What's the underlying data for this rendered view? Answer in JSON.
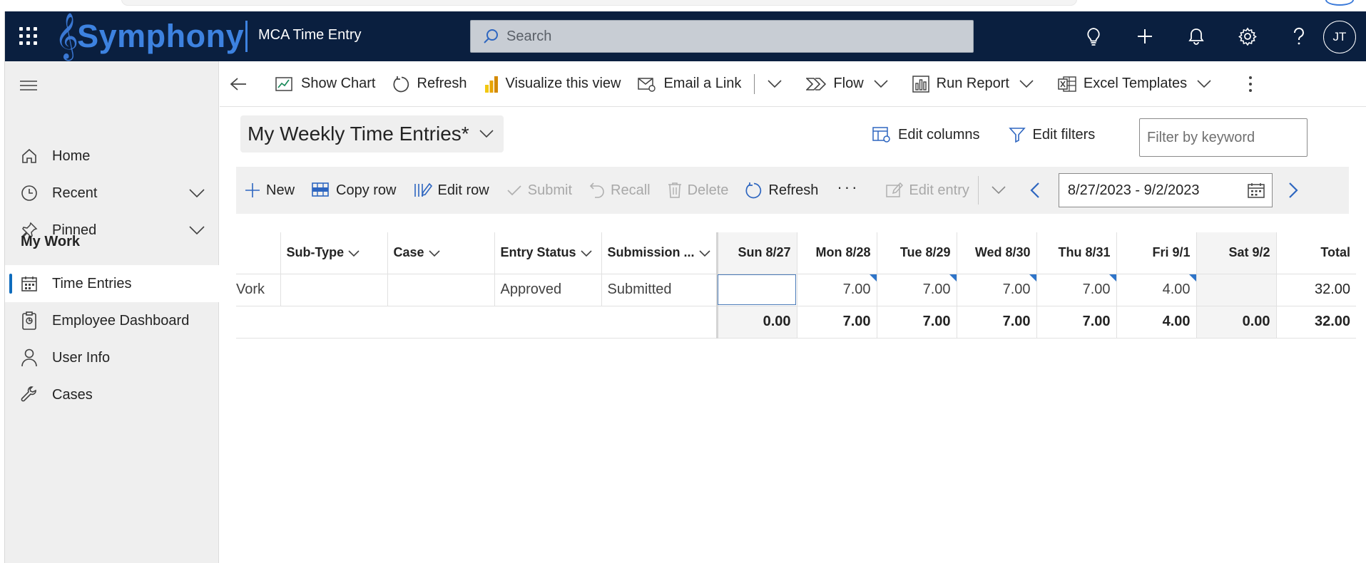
{
  "brand": {
    "name": "Symphony",
    "app_title": "MCA Time Entry"
  },
  "search": {
    "placeholder": "Search"
  },
  "user": {
    "initials": "JT"
  },
  "top_icons": [
    "lightbulb-icon",
    "plus-icon",
    "bell-icon",
    "gear-icon",
    "help-icon"
  ],
  "sidebar": {
    "items": [
      {
        "label": "Home",
        "icon": "home-icon"
      },
      {
        "label": "Recent",
        "icon": "clock-icon"
      },
      {
        "label": "Pinned",
        "icon": "pin-icon"
      }
    ],
    "section": "My Work",
    "work_items": [
      {
        "label": "Time Entries",
        "icon": "calendar-icon",
        "active": true
      },
      {
        "label": "Employee Dashboard",
        "icon": "dashboard-icon"
      },
      {
        "label": "User Info",
        "icon": "person-icon"
      },
      {
        "label": "Cases",
        "icon": "wrench-icon"
      }
    ]
  },
  "commandbar": {
    "show_chart": "Show Chart",
    "refresh": "Refresh",
    "visualize": "Visualize this view",
    "email_link": "Email a Link",
    "flow": "Flow",
    "run_report": "Run Report",
    "excel_templates": "Excel Templates"
  },
  "view": {
    "title": "My Weekly Time Entries*",
    "edit_columns": "Edit columns",
    "edit_filters": "Edit filters",
    "filter_placeholder": "Filter by keyword"
  },
  "gridbar": {
    "new": "New",
    "copy_row": "Copy row",
    "edit_row": "Edit row",
    "submit": "Submit",
    "recall": "Recall",
    "delete": "Delete",
    "refresh": "Refresh",
    "more": "···",
    "edit_entry": "Edit entry",
    "date_range": "8/27/2023 - 9/2/2023"
  },
  "table": {
    "columns": {
      "sub_type": "Sub-Type",
      "case": "Case",
      "entry_status": "Entry Status",
      "submission": "Submission ...",
      "sun": "Sun 8/27",
      "mon": "Mon 8/28",
      "tue": "Tue 8/29",
      "wed": "Wed 8/30",
      "thu": "Thu 8/31",
      "fri": "Fri 9/1",
      "sat": "Sat 9/2",
      "total": "Total"
    },
    "row": {
      "type_fragment": "Vork",
      "sub_type": "",
      "case": "",
      "entry_status": "Approved",
      "submission": "Submitted",
      "sun": "",
      "mon": "7.00",
      "tue": "7.00",
      "wed": "7.00",
      "thu": "7.00",
      "fri": "4.00",
      "sat": "",
      "total": "32.00"
    },
    "totals": {
      "sun": "0.00",
      "mon": "7.00",
      "tue": "7.00",
      "wed": "7.00",
      "thu": "7.00",
      "fri": "4.00",
      "sat": "0.00",
      "total": "32.00"
    }
  },
  "colors": {
    "topbar": "#0a1f3f",
    "brand": "#3d82e0",
    "accent": "#0f6cbd"
  }
}
